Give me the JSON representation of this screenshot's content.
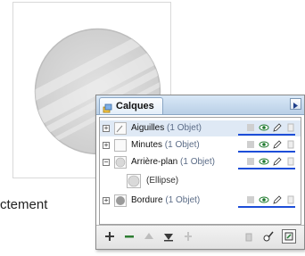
{
  "caption": "ctement",
  "panel": {
    "tab_label": "Calques",
    "layers": [
      {
        "name": "Aiguilles",
        "count": "(1 Objet)",
        "expanded": false,
        "selected": true
      },
      {
        "name": "Minutes",
        "count": "(1 Objet)",
        "expanded": false,
        "selected": false
      },
      {
        "name": "Arrière-plan",
        "count": "(1 Objet)",
        "expanded": true,
        "selected": false
      },
      {
        "name": "(Ellipse)",
        "count": "",
        "expanded": false,
        "selected": false
      },
      {
        "name": "Bordure",
        "count": "(1 Objet)",
        "expanded": false,
        "selected": false
      }
    ]
  },
  "colors": {
    "accent_underline": "#1d4ed8",
    "eye_green": "#1f7a2e",
    "header_blue": "#c7d9ee"
  },
  "icons": {
    "tab": "layers-icon",
    "menu": "panel-menu-icon",
    "toolbar": [
      "add-layer-icon",
      "delete-layer-icon",
      "move-up-icon",
      "move-down-icon",
      "merge-icon",
      "trash-icon",
      "layer-options-icon",
      "new-layer-icon"
    ]
  }
}
